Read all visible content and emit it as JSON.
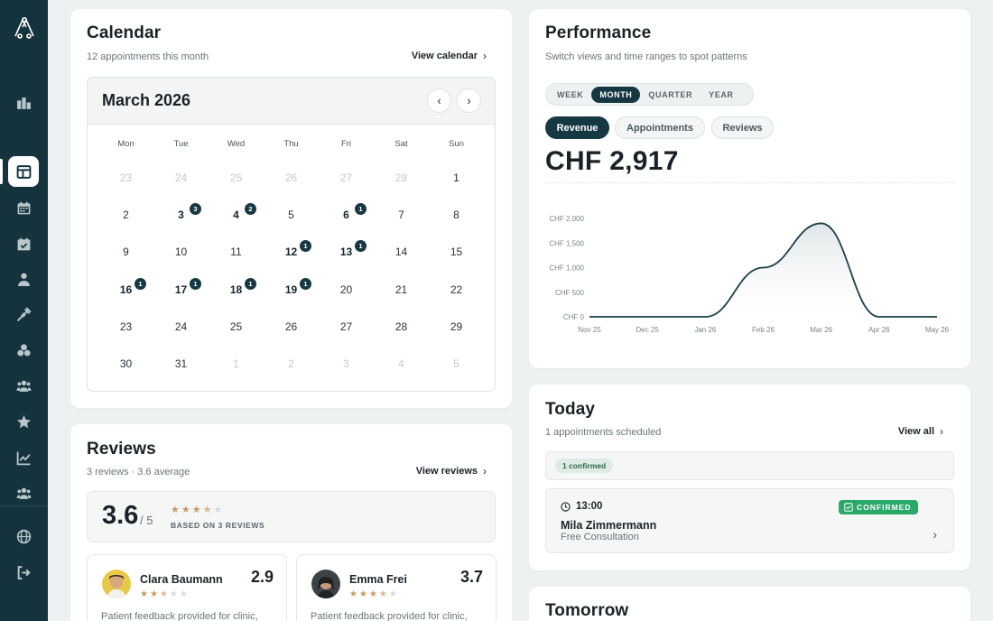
{
  "sidebar": {
    "items": [
      {
        "icon": "logo-icon"
      },
      {
        "icon": "building-icon"
      },
      {
        "icon": "layout-icon",
        "active": true
      },
      {
        "icon": "calendar-icon"
      },
      {
        "icon": "calendar-check-icon"
      },
      {
        "icon": "user-icon"
      },
      {
        "icon": "syringe-icon"
      },
      {
        "icon": "boxes-icon"
      },
      {
        "icon": "users-icon"
      },
      {
        "icon": "star-icon"
      },
      {
        "icon": "chart-line-icon"
      },
      {
        "icon": "team-icon"
      },
      {
        "icon": "globe-icon"
      },
      {
        "icon": "logout-icon"
      }
    ]
  },
  "calendar": {
    "title": "Calendar",
    "subtitle": "12 appointments this month",
    "view_link": "View calendar",
    "month_label": "March 2026",
    "weekdays": [
      "Mon",
      "Tue",
      "Wed",
      "Thu",
      "Fri",
      "Sat",
      "Sun"
    ],
    "days": [
      {
        "d": "23",
        "muted": true
      },
      {
        "d": "24",
        "muted": true
      },
      {
        "d": "25",
        "muted": true
      },
      {
        "d": "26",
        "muted": true
      },
      {
        "d": "27",
        "muted": true
      },
      {
        "d": "28",
        "muted": true
      },
      {
        "d": "1"
      },
      {
        "d": "2"
      },
      {
        "d": "3",
        "count": "3"
      },
      {
        "d": "4",
        "count": "2"
      },
      {
        "d": "5"
      },
      {
        "d": "6",
        "count": "1"
      },
      {
        "d": "7"
      },
      {
        "d": "8"
      },
      {
        "d": "9"
      },
      {
        "d": "10"
      },
      {
        "d": "11"
      },
      {
        "d": "12",
        "count": "1"
      },
      {
        "d": "13",
        "count": "1"
      },
      {
        "d": "14"
      },
      {
        "d": "15"
      },
      {
        "d": "16",
        "count": "1"
      },
      {
        "d": "17",
        "count": "1"
      },
      {
        "d": "18",
        "count": "1"
      },
      {
        "d": "19",
        "count": "1"
      },
      {
        "d": "20"
      },
      {
        "d": "21"
      },
      {
        "d": "22"
      },
      {
        "d": "23"
      },
      {
        "d": "24"
      },
      {
        "d": "25"
      },
      {
        "d": "26"
      },
      {
        "d": "27"
      },
      {
        "d": "28"
      },
      {
        "d": "29"
      },
      {
        "d": "30"
      },
      {
        "d": "31"
      },
      {
        "d": "1",
        "muted": true
      },
      {
        "d": "2",
        "muted": true
      },
      {
        "d": "3",
        "muted": true
      },
      {
        "d": "4",
        "muted": true
      },
      {
        "d": "5",
        "muted": true
      }
    ]
  },
  "reviews": {
    "title": "Reviews",
    "subtitle": "3 reviews · 3.6 average",
    "view_link": "View reviews",
    "average": "3.6",
    "out_of": "/ 5",
    "average_stars": 3.5,
    "based_on": "BASED ON 3 REVIEWS",
    "items": [
      {
        "name": "Clara Baumann",
        "score": "2.9",
        "stars": 2.5,
        "text": "Patient feedback provided for clinic,"
      },
      {
        "name": "Emma Frei",
        "score": "3.7",
        "stars": 3.5,
        "text": "Patient feedback provided for clinic,"
      }
    ]
  },
  "performance": {
    "title": "Performance",
    "subtitle": "Switch views and time ranges to spot patterns",
    "ranges": [
      "WEEK",
      "MONTH",
      "QUARTER",
      "YEAR"
    ],
    "active_range": "MONTH",
    "metrics": [
      "Revenue",
      "Appointments",
      "Reviews"
    ],
    "active_metric": "Revenue",
    "value": "CHF 2,917"
  },
  "chart_data": {
    "type": "area",
    "x": [
      "Nov 25",
      "Dec 25",
      "Jan 26",
      "Feb 26",
      "Mar 26",
      "Apr 26",
      "May 26"
    ],
    "series": [
      {
        "values": [
          0,
          0,
          0,
          1000,
          1900,
          0,
          0
        ]
      }
    ],
    "ytick_labels": [
      "CHF 0",
      "CHF 500",
      "CHF 1,000",
      "CHF 1,500",
      "CHF 2,000"
    ],
    "ylim": [
      0,
      2000
    ],
    "colors": {
      "line": "#1d3f4a",
      "fill": "#dfe5e7"
    }
  },
  "today": {
    "title": "Today",
    "subtitle": "1 appointments scheduled",
    "view_link": "View all",
    "confirmed_chip": "1 confirmed",
    "appointment": {
      "time": "13:00",
      "status": "CONFIRMED",
      "name": "Mila Zimmermann",
      "type": "Free Consultation"
    }
  },
  "tomorrow": {
    "title": "Tomorrow"
  },
  "colors": {
    "sidebar": "#14333d",
    "accent": "#163843",
    "confirmed": "#2aa86a",
    "star": "#c79b66"
  }
}
